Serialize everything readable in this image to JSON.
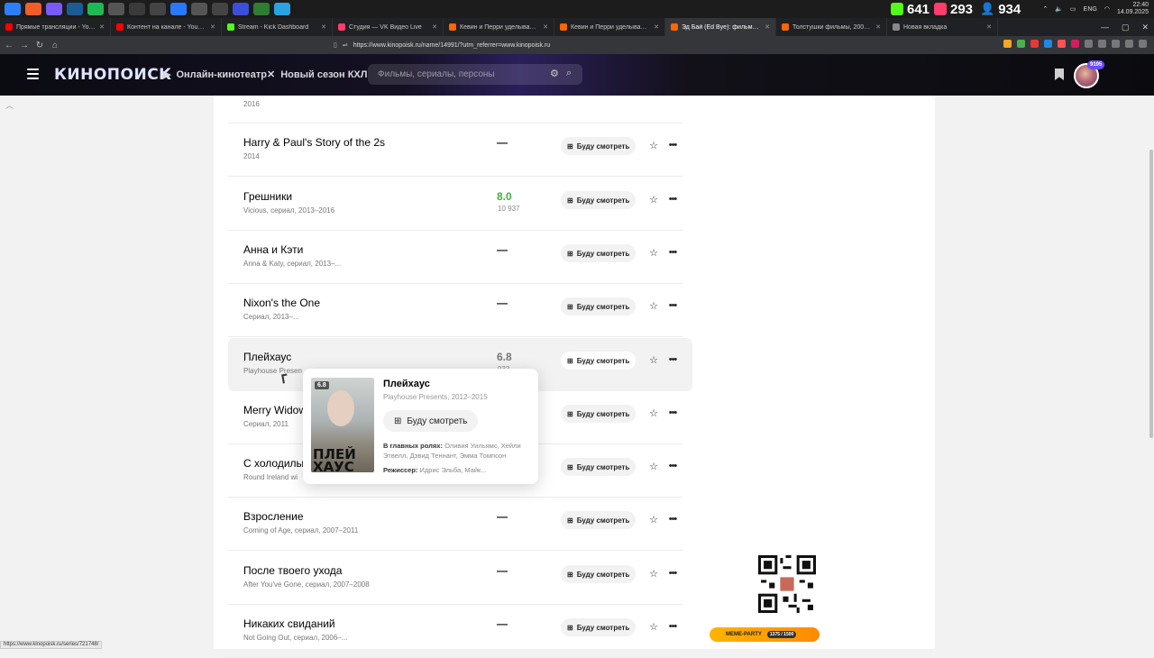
{
  "taskbar": {
    "apps": [
      {
        "name": "windows-icon",
        "color": "#2d7ff9"
      },
      {
        "name": "brave-icon",
        "color": "#f25d29"
      },
      {
        "name": "app-icon",
        "color": "#7a5af8"
      },
      {
        "name": "steam-icon",
        "color": "#1b5c94"
      },
      {
        "name": "spotify-icon",
        "color": "#1db954"
      },
      {
        "name": "app-icon",
        "color": "#555"
      },
      {
        "name": "app-icon",
        "color": "#3a3a3a"
      },
      {
        "name": "app-icon",
        "color": "#444"
      },
      {
        "name": "app-icon",
        "color": "#2979ff"
      },
      {
        "name": "app-icon",
        "color": "#555"
      },
      {
        "name": "app-icon",
        "color": "#444"
      },
      {
        "name": "app-icon",
        "color": "#3b4fd8"
      },
      {
        "name": "app-icon",
        "color": "#2e7d32"
      },
      {
        "name": "telegram-icon",
        "color": "#2aa3e0"
      }
    ],
    "stats": [
      {
        "name": "kick-followers",
        "value": "641",
        "color": "#53fc18"
      },
      {
        "name": "vk-live-viewers",
        "value": "293",
        "color": "#ff3d6d"
      },
      {
        "name": "viewers",
        "value": "934",
        "color": "#4fa3ff"
      }
    ],
    "lang": "ENG",
    "time": "22:40",
    "date": "14.09.2025"
  },
  "tabs": [
    {
      "label": "Прямые трансляции - YouTube Stu",
      "color": "#ff0000",
      "active": false
    },
    {
      "label": "Контент на канале - YouTube Studio",
      "color": "#ff0000",
      "active": false
    },
    {
      "label": "Stream - Kick Dashboard",
      "color": "#53fc18",
      "active": false
    },
    {
      "label": "Студия — VK Видео Live",
      "color": "#ff3d6d",
      "active": false
    },
    {
      "label": "Кевин и Перри уделывают всех / K",
      "color": "#ff6600",
      "active": false
    },
    {
      "label": "Кевин и Перри уделывают всех фи",
      "color": "#ff6600",
      "active": false
    },
    {
      "label": "Эд Бай (Ed Bye): фильмы, биогр",
      "color": "#ff6600",
      "active": true
    },
    {
      "label": "Толстушки фильмы, 2004, дата вых",
      "color": "#ff6600",
      "active": false
    },
    {
      "label": "Новая вкладка",
      "color": "#888",
      "active": false
    }
  ],
  "address": {
    "url": "https://www.kinopoisk.ru/name/14991/?utm_referrer=www.kinopoisk.ru"
  },
  "header": {
    "logo": "КИНОПОИСК",
    "online_cinema": "Онлайн-кинотеатр",
    "khl": "Новый сезон КХЛ",
    "search_placeholder": "Фильмы, сериалы, персоны",
    "points": "9195"
  },
  "rows": [
    {
      "title": "",
      "sub": "2016",
      "rating": "",
      "votes": "",
      "rating_style": "none"
    },
    {
      "title": "Harry & Paul's Story of the 2s",
      "sub": "2014",
      "rating": "—",
      "votes": "",
      "rating_style": "dash"
    },
    {
      "title": "Грешники",
      "sub": "Vicious, сериал, 2013–2016",
      "rating": "8.0",
      "votes": "10 937",
      "rating_style": "green"
    },
    {
      "title": "Анна и Кэти",
      "sub": "Anna & Katy, сериал, 2013–...",
      "rating": "—",
      "votes": "",
      "rating_style": "dash"
    },
    {
      "title": "Nixon's the One",
      "sub": "Сериал, 2013–...",
      "rating": "—",
      "votes": "",
      "rating_style": "dash"
    },
    {
      "title": "Плейхаус",
      "sub": "Playhouse Presen",
      "rating": "6.8",
      "votes": "933",
      "rating_style": "grey"
    },
    {
      "title": "Merry Widow",
      "sub": "Сериал, 2011",
      "rating": "",
      "votes": "",
      "rating_style": "none"
    },
    {
      "title": "С холодилы",
      "sub": "Round Ireland wi",
      "rating": "",
      "votes": "",
      "rating_style": "none"
    },
    {
      "title": "Взросление",
      "sub": "Coming of Age, сериал, 2007–2011",
      "rating": "—",
      "votes": "",
      "rating_style": "dash"
    },
    {
      "title": "После твоего ухода",
      "sub": "After You've Gone, сериал, 2007–2008",
      "rating": "—",
      "votes": "",
      "rating_style": "dash"
    },
    {
      "title": "Никаких свиданий",
      "sub": "Not Going Out, сериал, 2006–...",
      "rating": "—",
      "votes": "",
      "rating_style": "dash"
    }
  ],
  "watch_label": "Буду смотреть",
  "popup": {
    "rating": "6.8",
    "title": "Плейхаус",
    "sub": "Playhouse Presents, 2012–2015",
    "watch_label": "Буду смотреть",
    "cast_label": "В главных ролях:",
    "cast": "Оливия Уильямс, Хейли Этвелл, Дэвид Теннант, Эмма Томпсон",
    "director_label": "Режиссер:",
    "director": "Идрис Эльба, Майк...",
    "poster_text": "ПЛЕЙ ХАУС"
  },
  "overlay": {
    "meme_label": "MEME-PARTY",
    "meme_progress": "1375 / 1500"
  },
  "status_url": "https://www.kinopoisk.ru/series/721748/"
}
